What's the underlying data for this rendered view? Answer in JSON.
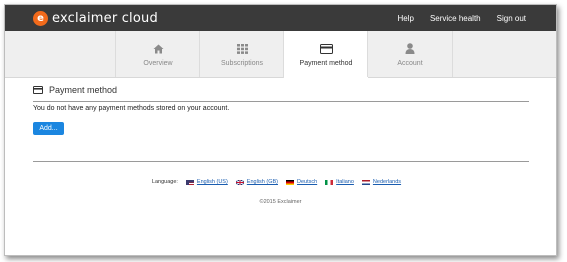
{
  "header": {
    "logo_text": "exclaimer cloud",
    "links": [
      "Help",
      "Service health",
      "Sign out"
    ]
  },
  "tabs": [
    {
      "label": "Overview",
      "icon": "home-icon",
      "active": false
    },
    {
      "label": "Subscriptions",
      "icon": "grid-icon",
      "active": false
    },
    {
      "label": "Payment method",
      "icon": "credit-card-icon",
      "active": true
    },
    {
      "label": "Account",
      "icon": "user-icon",
      "active": false
    }
  ],
  "page": {
    "title": "Payment method",
    "message": "You do not have any payment methods stored on your account.",
    "add_button": "Add..."
  },
  "footer": {
    "language_label": "Language:",
    "languages": [
      "English (US)",
      "English (GB)",
      "Deutsch",
      "Italiano",
      "Nederlands"
    ],
    "copyright": "©2015 Exclaimer"
  },
  "colors": {
    "topbar": "#3a3a3a",
    "brand": "#f26a1b",
    "button": "#1b86e0",
    "link": "#1a5db0"
  }
}
